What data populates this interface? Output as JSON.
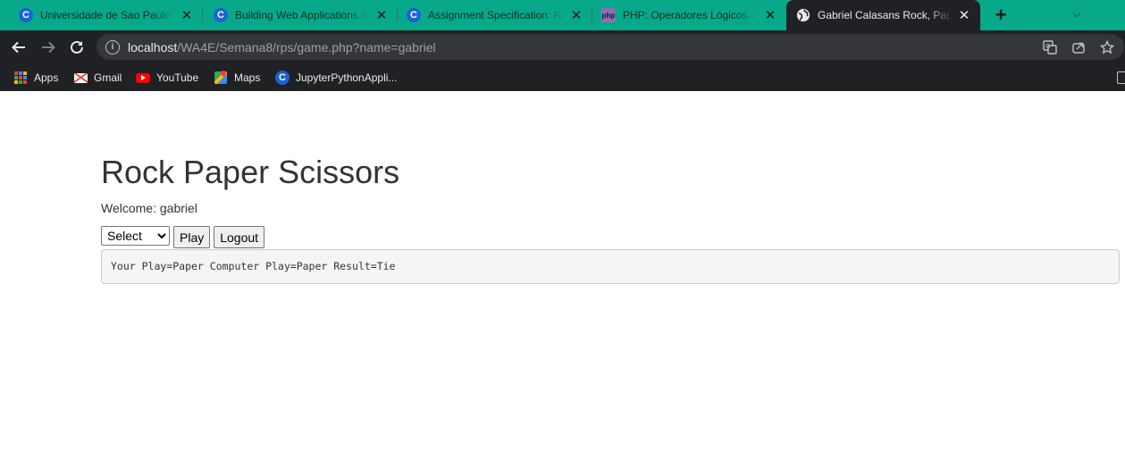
{
  "tabs": [
    {
      "title": "Universidade de Sao Paulo Bl",
      "favicon": "coursera-c-icon"
    },
    {
      "title": "Building Web Applications in",
      "favicon": "coursera-c-icon"
    },
    {
      "title": "Assignment Specification: Ro",
      "favicon": "coursera-c-icon"
    },
    {
      "title": "PHP: Operadores Lógicos - M",
      "favicon": "php-icon",
      "favicon_text": "php"
    },
    {
      "title": "Gabriel Calasans Rock, Paper,",
      "favicon": "globe-icon",
      "active": true
    }
  ],
  "favicon_letter": "C",
  "toolbar": {
    "url_host": "localhost",
    "url_path": "/WA4E/Semana8/rps/game.php?name=gabriel"
  },
  "bookmarks": [
    {
      "label": "Apps",
      "icon": "apps-grid-icon"
    },
    {
      "label": "Gmail",
      "icon": "gmail-icon"
    },
    {
      "label": "YouTube",
      "icon": "youtube-icon"
    },
    {
      "label": "Maps",
      "icon": "maps-icon"
    },
    {
      "label": "JupyterPythonAppli...",
      "icon": "coursera-c-icon"
    }
  ],
  "page": {
    "title": "Rock Paper Scissors",
    "welcome": "Welcome: gabriel",
    "select_value": "Select",
    "play_label": "Play",
    "logout_label": "Logout",
    "result_text": "Your Play=Paper Computer Play=Paper Result=Tie"
  },
  "colors": {
    "tabstrip": "#07a98a",
    "toolbar": "#202124",
    "omnibox": "#35363a",
    "result_bg": "#f5f5f5",
    "text": "#333333"
  }
}
